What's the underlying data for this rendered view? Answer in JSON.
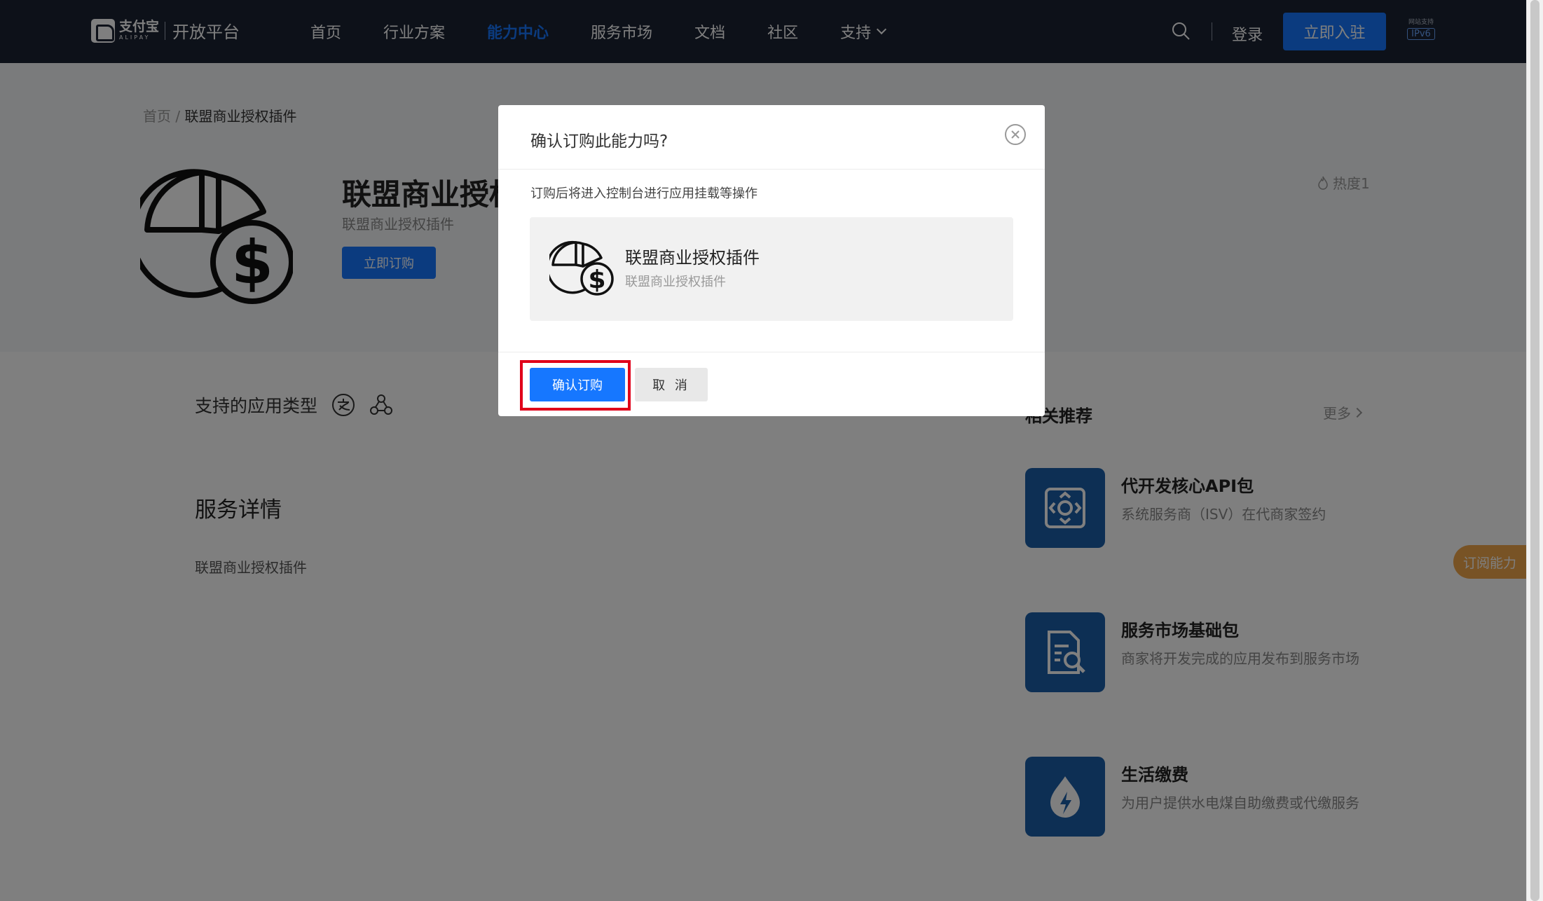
{
  "header": {
    "logo_cn": "支付宝",
    "logo_en": "ALIPAY",
    "platform": "开放平台",
    "nav": [
      "首页",
      "行业方案",
      "能力中心",
      "服务市场",
      "文档",
      "社区",
      "支持"
    ],
    "active_nav": "能力中心",
    "login": "登录",
    "join": "立即入驻",
    "ipv6_label": "网站支持",
    "ipv6_badge": "IPv6"
  },
  "breadcrumb": {
    "home": "首页",
    "sep": " / ",
    "current": "联盟商业授权插件"
  },
  "product": {
    "title": "联盟商业授权插件",
    "subtitle": "联盟商业授权插件",
    "order_button": "立即订购",
    "heat": "热度1"
  },
  "app_types_label": "支持的应用类型",
  "service": {
    "title": "服务详情",
    "description": "联盟商业授权插件"
  },
  "recommend": {
    "title": "相关推荐",
    "more": "更多",
    "items": [
      {
        "name": "代开发核心API包",
        "desc": "系统服务商（ISV）在代商家签约"
      },
      {
        "name": "服务市场基础包",
        "desc": "商家将开发完成的应用发布到服务市场"
      },
      {
        "name": "生活缴费",
        "desc": "为用户提供水电煤自助缴费或代缴服务"
      }
    ]
  },
  "float_tab": "订阅能力",
  "modal": {
    "title": "确认订购此能力吗?",
    "description": "订购后将进入控制台进行应用挂载等操作",
    "card_title": "联盟商业授权插件",
    "card_subtitle": "联盟商业授权插件",
    "confirm": "确认订购",
    "cancel": "取 消"
  },
  "colors": {
    "header_bg": "#1a2233",
    "primary": "#1677ff",
    "highlight": "#e0001a",
    "recommend_icon": "#1b5fa8"
  }
}
